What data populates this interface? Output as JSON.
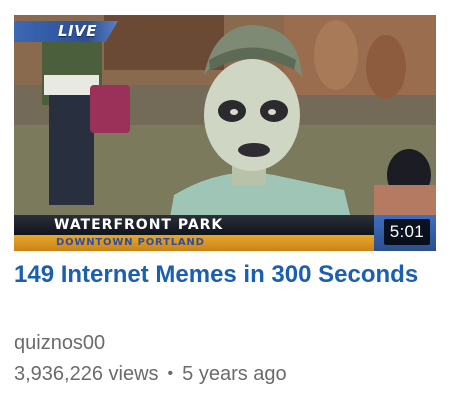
{
  "video": {
    "thumbnail": {
      "live_badge": "LIVE",
      "lower_third_title": "WATERFRONT PARK",
      "lower_third_subtitle": "DOWNTOWN PORTLAND",
      "duration": "5:01"
    },
    "title": "149 Internet Memes in 300 Seconds",
    "channel": "quiznos00",
    "views": "3,936,226 views",
    "separator": "•",
    "age": "5 years ago"
  },
  "colors": {
    "title_link": "#1a5fb4",
    "meta_text": "#6b6b6b",
    "live_badge": "#3c68b5",
    "lower_third_accent": "#e8a52a"
  }
}
